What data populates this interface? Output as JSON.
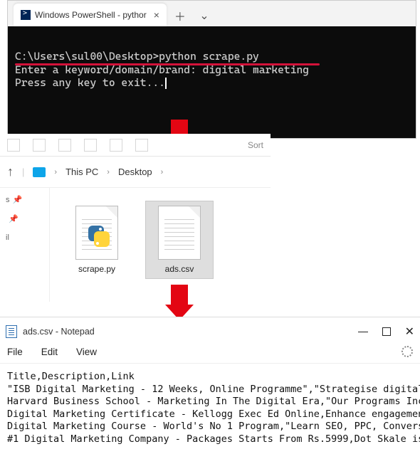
{
  "terminal": {
    "tab_title": "Windows PowerShell - pythor",
    "lines": {
      "l1": "C:\\Users\\sul00\\Desktop>python scrape.py",
      "l2": "Enter a keyword/domain/brand: digital marketing",
      "l3": "Press any key to exit..."
    }
  },
  "explorer": {
    "toolbar_sort": "Sort",
    "breadcrumb": {
      "a": "This PC",
      "b": "Desktop"
    },
    "files": {
      "f1": "scrape.py",
      "f2": "ads.csv"
    },
    "side": {
      "s1": "s",
      "s2": "",
      "s3": "il"
    }
  },
  "notepad": {
    "title": "ads.csv - Notepad",
    "menu": {
      "file": "File",
      "edit": "Edit",
      "view": "View"
    },
    "content": "Title,Description,Link\n\"ISB Digital Marketing - 12 Weeks, Online Programme\",\"Strategise digital\nHarvard Business School - Marketing In The Digital Era,\"Our Programs Inc\nDigital Marketing Certificate - Kellogg Exec Ed Online,Enhance engagemen\nDigital Marketing Course - World's No 1 Program,\"Learn SEO, PPC, Convers\n#1 Digital Marketing Company - Packages Starts From Rs.5999,Dot Skale is"
  }
}
